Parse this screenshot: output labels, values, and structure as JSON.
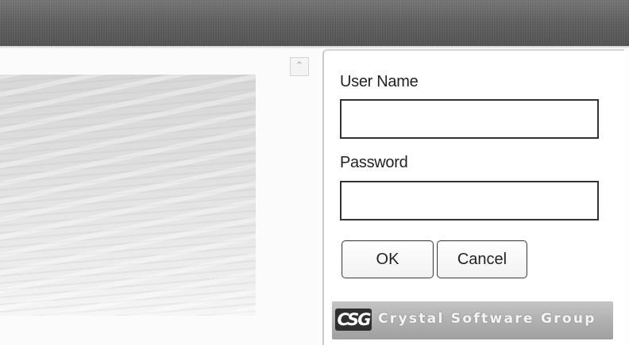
{
  "login_form": {
    "username_label": "User Name",
    "username_value": "",
    "password_label": "Password",
    "password_value": "",
    "ok_label": "OK",
    "cancel_label": "Cancel"
  },
  "branding": {
    "logo_text": "CSG",
    "company_name": "Crystal Software Group"
  },
  "icons": {
    "scroll_up": "chevron-up-icon",
    "scroll_up_glyph": "⌃"
  },
  "colors": {
    "title_bar": "#595959",
    "input_border": "#333333",
    "brand_bar": "#b1b1b1"
  }
}
